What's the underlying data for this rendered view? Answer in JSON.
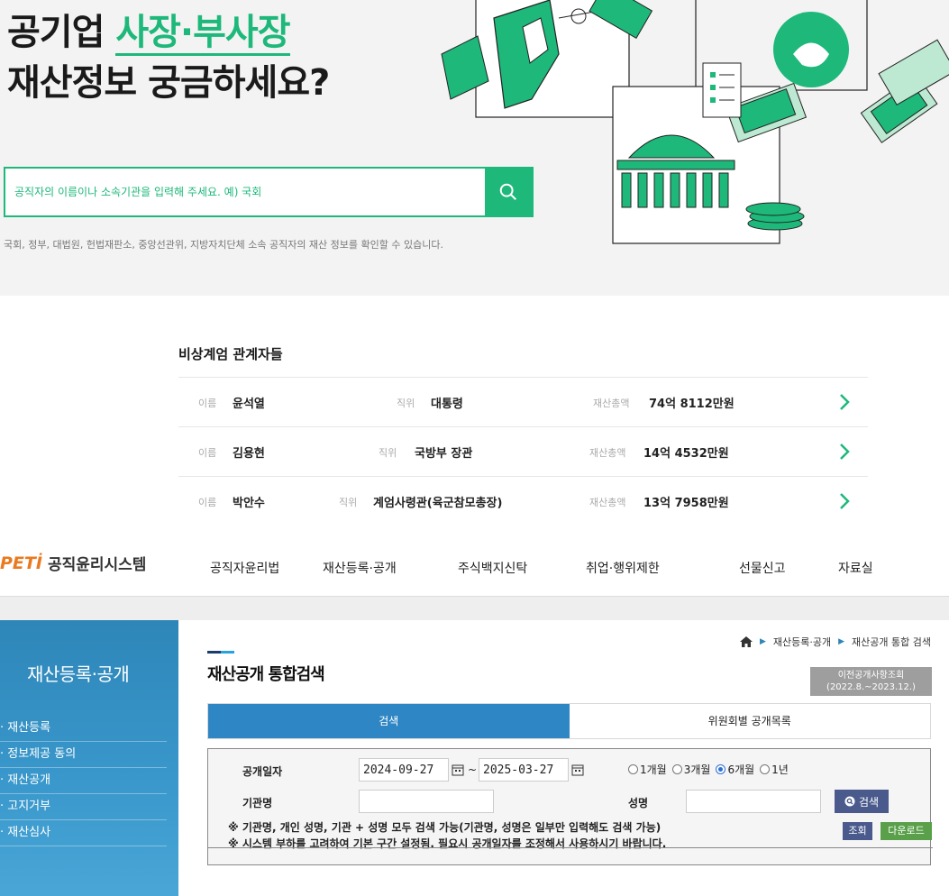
{
  "hero": {
    "title_pre": "공기업 ",
    "title_accent": "사장·부사장",
    "title_line2": "재산정보 궁금하세요?",
    "search_placeholder": "공직자의 이름이나 소속기관을 입력해 주세요. 예) 국회",
    "note": "국회, 정부, 대법원, 헌법재판소, 중앙선관위, 지방자치단체 소속 공직자의 재산 정보를 확인할 수 있습니다.",
    "accent_color": "#1db87a"
  },
  "related": {
    "title": "비상계엄 관계자들",
    "name_label": "이름",
    "position_label": "직위",
    "asset_label": "재산총액",
    "rows": [
      {
        "name": "윤석열",
        "position": "대통령",
        "asset": "74억 8112만원"
      },
      {
        "name": "김용현",
        "position": "국방부 장관",
        "asset": "14억 4532만원"
      },
      {
        "name": "박안수",
        "position": "계엄사령관(육군참모총장)",
        "asset": "13억 7958만원"
      }
    ]
  },
  "nav": {
    "logo_mark": "PETİ",
    "logo_text": "공직윤리시스템",
    "items": [
      "공직자윤리법",
      "재산등록·공개",
      "주식백지신탁",
      "취업·행위제한",
      "선물신고",
      "자료실"
    ]
  },
  "sidebar": {
    "title": "재산등록·공개",
    "items": [
      "· 재산등록",
      "· 정보제공 동의",
      "· 재산공개",
      "· 고지거부",
      "· 재산심사"
    ]
  },
  "main": {
    "breadcrumb": [
      "재산등록·공개",
      "재산공개 통합 검색"
    ],
    "page_title": "재산공개 통합검색",
    "prev_button_line1": "이전공개사항조회",
    "prev_button_line2": "(2022.8.~2023.12.)",
    "tabs": [
      "검색",
      "위원회별 공개목록"
    ]
  },
  "form": {
    "date_label": "공개일자",
    "date_from": "2024-09-27",
    "date_sep": "~",
    "date_to": "2025-03-27",
    "periods": [
      "1개월",
      "3개월",
      "6개월",
      "1년"
    ],
    "selected_period": "6개월",
    "org_label": "기관명",
    "name_label": "성명",
    "search_button": "검색",
    "note1": "※ 기관명, 개인 성명, 기관 + 성명 모두 검색 가능(기관명, 성명은 일부만 입력해도 검색 가능)",
    "note2": "※ 시스템 부하를 고려하여 기본 구간 설정됨. 필요시 공개일자를 조정해서 사용하시기 바랍니다."
  },
  "actions": {
    "view": "조회",
    "download": "다운로드"
  }
}
